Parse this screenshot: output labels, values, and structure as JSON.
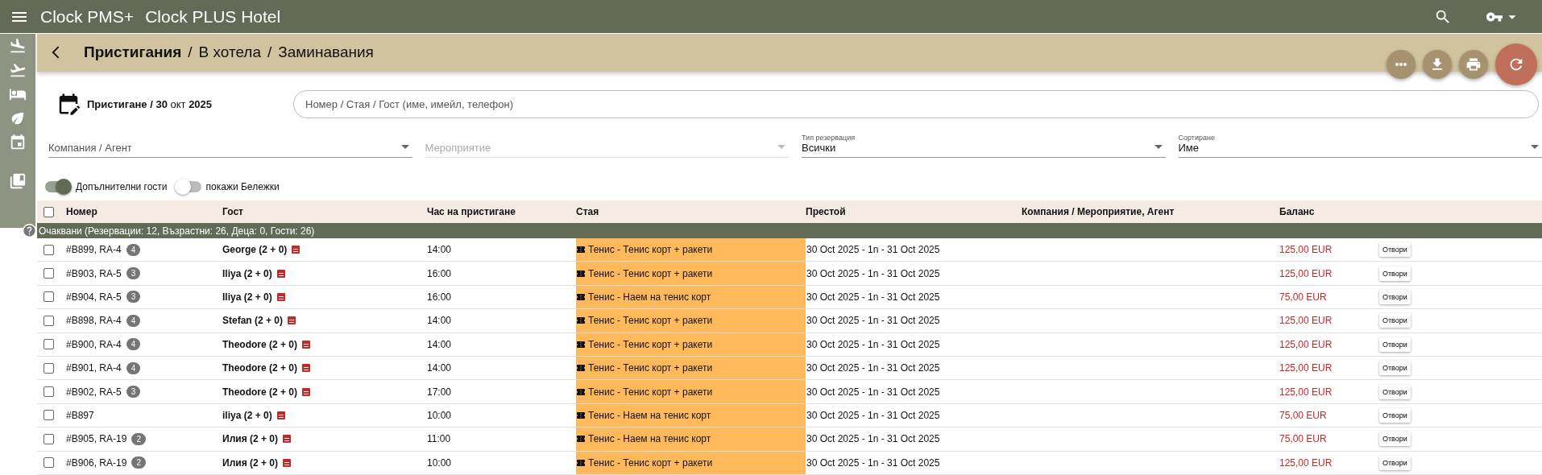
{
  "app_bar": {
    "product": "Clock PMS+",
    "hotel": "Clock PLUS Hotel"
  },
  "sidebar": {
    "items": [
      {
        "kind": "landing"
      },
      {
        "kind": "takeoff"
      },
      {
        "kind": "bed"
      },
      {
        "kind": "leaf"
      },
      {
        "kind": "calendar"
      },
      {
        "kind": "bookmark"
      }
    ]
  },
  "breadcrumb": {
    "separators": [
      "/",
      "/"
    ],
    "items": [
      {
        "label": "Пристигания",
        "selected": true
      },
      {
        "label": "В хотела",
        "selected": false
      },
      {
        "label": "Заминавания",
        "selected": false
      }
    ]
  },
  "actions": [
    {
      "kind": "more"
    },
    {
      "kind": "download"
    },
    {
      "kind": "print"
    },
    {
      "kind": "refresh"
    }
  ],
  "date": "**Пристигане / 30** окт **2025**",
  "search": {
    "placeholder": "Номер / Стая / Гост (име, имейл, телефон)"
  },
  "filters": [
    {
      "placeholder": "Компания / Агент",
      "disabled": false
    },
    {
      "placeholder": "Мероприятие",
      "disabled": true
    },
    {
      "label": "Тип резервация",
      "value": "Всички",
      "disabled": false
    },
    {
      "label": "Сортиране",
      "value": "Име",
      "disabled": false
    }
  ],
  "toggles": [
    {
      "label": "Допълнителни гости",
      "on": true
    },
    {
      "label": "покажи Бележки",
      "on": false
    }
  ],
  "table": {
    "select_all_checked": false,
    "columns": [
      "Номер",
      "Гост",
      "Час на пристигане",
      "Стая",
      "Престой",
      "Компания / Мероприятие, Агент",
      "Баланс"
    ],
    "group": "Очаквани (Резервации: 12, Възрастни: 26, Деца: 0, Гости: 26)",
    "rows": [
      {
        "checked": false,
        "number": "#B899, RA-4",
        "badge": "4",
        "guest": "George (2 + 0)",
        "time": "14:00",
        "room": "Тенис - Тенис корт + ракети",
        "stay": "30 Oct 2025 - 1n - 31 Oct 2025",
        "balance": "125,00 EUR",
        "button": "Отвори"
      },
      {
        "checked": false,
        "number": "#B903, RA-5",
        "badge": "3",
        "guest": "Iliya (2 + 0)",
        "time": "16:00",
        "room": "Тенис - Тенис корт + ракети",
        "stay": "30 Oct 2025 - 1n - 31 Oct 2025",
        "balance": "125,00 EUR",
        "button": "Отвори"
      },
      {
        "checked": false,
        "number": "#B904, RA-5",
        "badge": "3",
        "guest": "Iliya (2 + 0)",
        "time": "16:00",
        "room": "Тенис - Наем на тенис корт",
        "stay": "30 Oct 2025 - 1n - 31 Oct 2025",
        "balance": "75,00 EUR",
        "button": "Отвори"
      },
      {
        "checked": false,
        "number": "#B898, RA-4",
        "badge": "4",
        "guest": "Stefan (2 + 0)",
        "time": "14:00",
        "room": "Тенис - Тенис корт + ракети",
        "stay": "30 Oct 2025 - 1n - 31 Oct 2025",
        "balance": "125,00 EUR",
        "button": "Отвори"
      },
      {
        "checked": false,
        "number": "#B900, RA-4",
        "badge": "4",
        "guest": "Theodore (2 + 0)",
        "time": "14:00",
        "room": "Тенис - Тенис корт + ракети",
        "stay": "30 Oct 2025 - 1n - 31 Oct 2025",
        "balance": "125,00 EUR",
        "button": "Отвори"
      },
      {
        "checked": false,
        "number": "#B901, RA-4",
        "badge": "4",
        "guest": "Theodore (2 + 0)",
        "time": "14:00",
        "room": "Тенис - Тенис корт + ракети",
        "stay": "30 Oct 2025 - 1n - 31 Oct 2025",
        "balance": "125,00 EUR",
        "button": "Отвори"
      },
      {
        "checked": false,
        "number": "#B902, RA-5",
        "badge": "3",
        "guest": "Theodore (2 + 0)",
        "time": "17:00",
        "room": "Тенис - Тенис корт + ракети",
        "stay": "30 Oct 2025 - 1n - 31 Oct 2025",
        "balance": "125,00 EUR",
        "button": "Отвори"
      },
      {
        "checked": false,
        "number": "#B897",
        "guest": "iliya (2 + 0)",
        "time": "10:00",
        "room": "Тенис - Наем на тенис корт",
        "stay": "30 Oct 2025 - 1n - 31 Oct 2025",
        "balance": "75,00 EUR",
        "button": "Отвори"
      },
      {
        "checked": false,
        "number": "#B905, RA-19",
        "badge": "2",
        "guest": "Илия (2 + 0)",
        "time": "11:00",
        "room": "Тенис - Наем на тенис корт",
        "stay": "30 Oct 2025 - 1n - 31 Oct 2025",
        "balance": "75,00 EUR",
        "button": "Отвори"
      },
      {
        "checked": false,
        "number": "#B906, RA-19",
        "badge": "2",
        "guest": "Илия (2 + 0)",
        "time": "10:00",
        "room": "Тенис - Тенис корт + ракети",
        "stay": "30 Oct 2025 - 1n - 31 Oct 2025",
        "balance": "125,00 EUR",
        "button": "Отвори"
      }
    ]
  }
}
